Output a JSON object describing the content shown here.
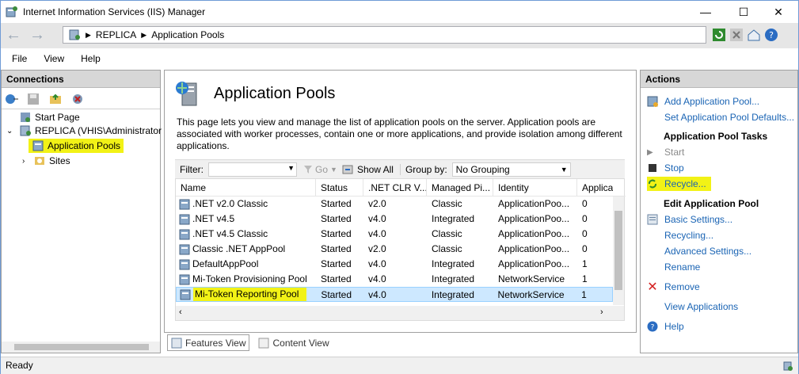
{
  "window": {
    "title": "Internet Information Services (IIS) Manager",
    "min": "—",
    "max": "☐",
    "close": "✕"
  },
  "address": {
    "crumbs": [
      "REPLICA",
      "Application Pools"
    ],
    "help": "?"
  },
  "menu": [
    "File",
    "View",
    "Help"
  ],
  "connections": {
    "header": "Connections",
    "tree": {
      "start_page": "Start Page",
      "server": "REPLICA (VHIS\\Administrator",
      "app_pools": "Application Pools",
      "sites": "Sites"
    }
  },
  "center": {
    "title": "Application Pools",
    "description": "This page lets you view and manage the list of application pools on the server. Application pools are associated with worker processes, contain one or more applications, and provide isolation among different applications.",
    "filter_label": "Filter:",
    "go_label": "Go",
    "show_all_label": "Show All",
    "group_by_label": "Group by:",
    "group_by_value": "No Grouping",
    "columns": [
      "Name",
      "Status",
      ".NET CLR V...",
      "Managed Pi...",
      "Identity",
      "Applica"
    ],
    "rows": [
      {
        "name": ".NET v2.0 Classic",
        "status": "Started",
        "clr": "v2.0",
        "pipeline": "Classic",
        "identity": "ApplicationPoo...",
        "apps": "0"
      },
      {
        "name": ".NET v4.5",
        "status": "Started",
        "clr": "v4.0",
        "pipeline": "Integrated",
        "identity": "ApplicationPoo...",
        "apps": "0"
      },
      {
        "name": ".NET v4.5 Classic",
        "status": "Started",
        "clr": "v4.0",
        "pipeline": "Classic",
        "identity": "ApplicationPoo...",
        "apps": "0"
      },
      {
        "name": "Classic .NET AppPool",
        "status": "Started",
        "clr": "v2.0",
        "pipeline": "Classic",
        "identity": "ApplicationPoo...",
        "apps": "0"
      },
      {
        "name": "DefaultAppPool",
        "status": "Started",
        "clr": "v4.0",
        "pipeline": "Integrated",
        "identity": "ApplicationPoo...",
        "apps": "1"
      },
      {
        "name": "Mi-Token Provisioning Pool",
        "status": "Started",
        "clr": "v4.0",
        "pipeline": "Integrated",
        "identity": "NetworkService",
        "apps": "1"
      },
      {
        "name": "Mi-Token Reporting Pool",
        "status": "Started",
        "clr": "v4.0",
        "pipeline": "Integrated",
        "identity": "NetworkService",
        "apps": "1"
      }
    ],
    "features_view": "Features View",
    "content_view": "Content View"
  },
  "actions": {
    "header": "Actions",
    "add_pool": "Add Application Pool...",
    "set_defaults": "Set Application Pool Defaults...",
    "tasks_header": "Application Pool Tasks",
    "start": "Start",
    "stop": "Stop",
    "recycle": "Recycle...",
    "edit_header": "Edit Application Pool",
    "basic_settings": "Basic Settings...",
    "recycling": "Recycling...",
    "advanced_settings": "Advanced Settings...",
    "rename": "Rename",
    "remove": "Remove",
    "view_apps": "View Applications",
    "help": "Help"
  },
  "status": {
    "text": "Ready"
  },
  "colors": {
    "highlight": "#f2f216",
    "link": "#1a64b4",
    "selection": "#cde8ff"
  }
}
